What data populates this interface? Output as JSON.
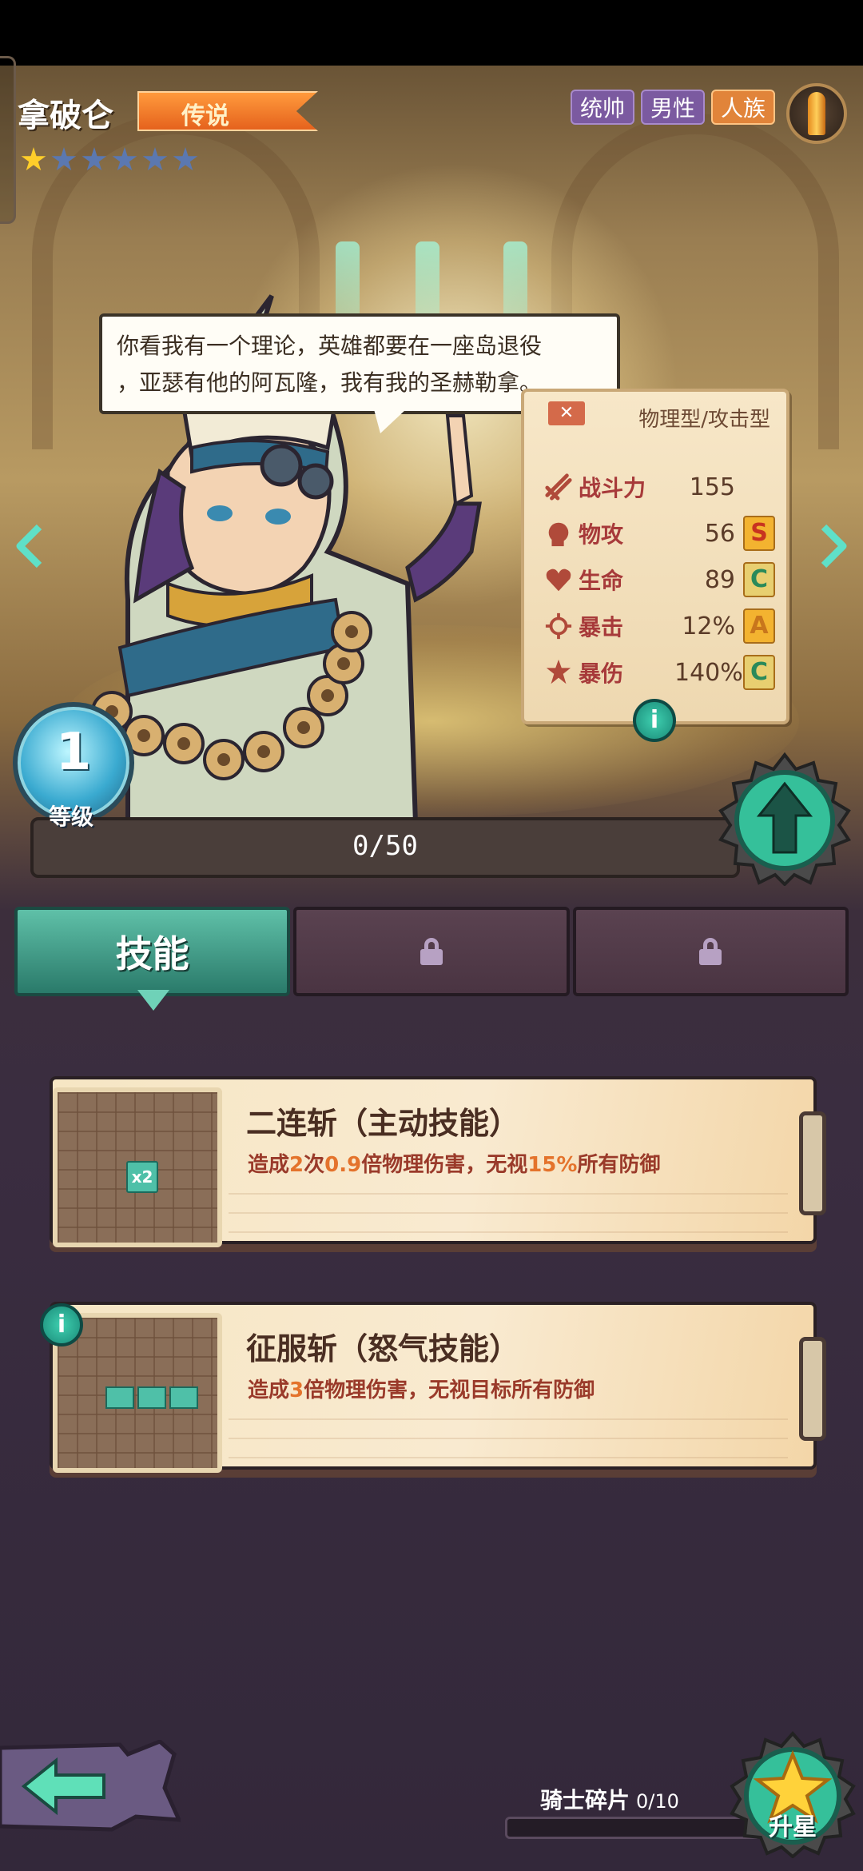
{
  "hero": {
    "name": "拿破仑",
    "rarity": "传说",
    "stars_total": 6,
    "stars_filled": 1,
    "tags": [
      "统帅",
      "男性",
      "人族"
    ],
    "quote": {
      "line1": "你看我有一个理论，英雄都要在一座岛退役",
      "line2": "，亚瑟有他的阿瓦隆，我有我的圣赫勒拿。"
    }
  },
  "stats": {
    "type": "物理型/攻击型",
    "rows": [
      {
        "label": "战斗力",
        "value": "155",
        "grade": "",
        "icon": "power-icon"
      },
      {
        "label": "物攻",
        "value": "56",
        "grade": "S",
        "icon": "fist-icon"
      },
      {
        "label": "生命",
        "value": "89",
        "grade": "C",
        "icon": "heart-icon"
      },
      {
        "label": "暴击",
        "value": "12%",
        "grade": "A",
        "icon": "crit-icon"
      },
      {
        "label": "暴伤",
        "value": "140%",
        "grade": "C",
        "icon": "crit-damage-icon"
      }
    ]
  },
  "level": {
    "value": "1",
    "label": "等级",
    "exp_text": "0/50",
    "exp_fraction": 0
  },
  "tabs": [
    {
      "label": "技能",
      "locked": false
    },
    {
      "label": "",
      "locked": true
    },
    {
      "label": "",
      "locked": true
    }
  ],
  "skills": [
    {
      "title": "二连斩（主动技能）",
      "desc_parts": [
        "造成",
        "2",
        "次",
        "0.9",
        "倍物理伤害，无视",
        "15%",
        "所有防御"
      ],
      "icon_badge": "x2"
    },
    {
      "title": "征服斩（怒气技能）",
      "desc_parts": [
        "造成",
        "3",
        "倍物理伤害，无视目标所有防御"
      ]
    }
  ],
  "bottom": {
    "shards_label": "骑士碎片",
    "shards_count": "0/10",
    "shards_fraction": 0,
    "starup_label": "升星"
  },
  "colors": {
    "accent_teal": "#2f8f86",
    "rarity_orange": "#e5621d",
    "star_gold": "#ffce2a"
  }
}
